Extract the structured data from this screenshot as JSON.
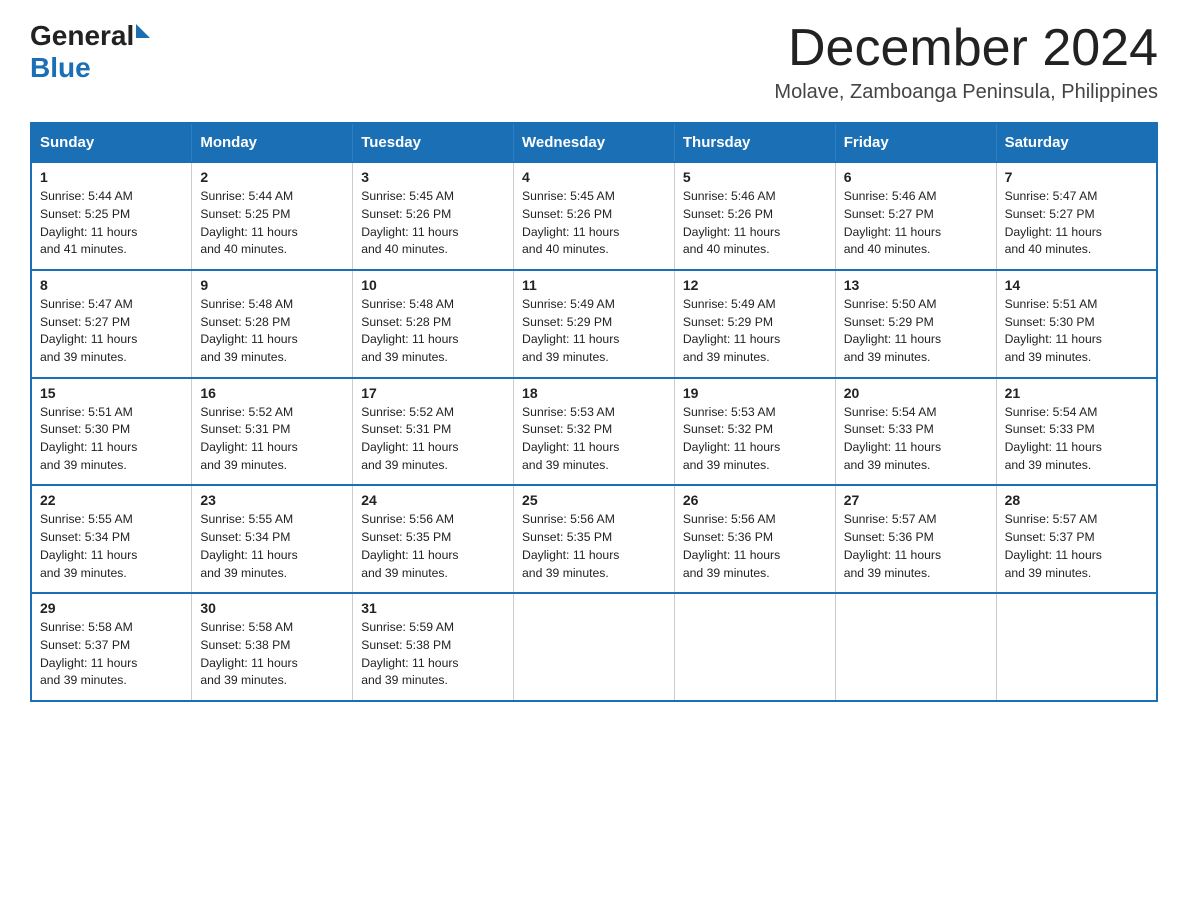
{
  "logo": {
    "general": "General",
    "blue": "Blue"
  },
  "title": "December 2024",
  "subtitle": "Molave, Zamboanga Peninsula, Philippines",
  "header_days": [
    "Sunday",
    "Monday",
    "Tuesday",
    "Wednesday",
    "Thursday",
    "Friday",
    "Saturday"
  ],
  "weeks": [
    [
      {
        "day": "1",
        "info": "Sunrise: 5:44 AM\nSunset: 5:25 PM\nDaylight: 11 hours\nand 41 minutes."
      },
      {
        "day": "2",
        "info": "Sunrise: 5:44 AM\nSunset: 5:25 PM\nDaylight: 11 hours\nand 40 minutes."
      },
      {
        "day": "3",
        "info": "Sunrise: 5:45 AM\nSunset: 5:26 PM\nDaylight: 11 hours\nand 40 minutes."
      },
      {
        "day": "4",
        "info": "Sunrise: 5:45 AM\nSunset: 5:26 PM\nDaylight: 11 hours\nand 40 minutes."
      },
      {
        "day": "5",
        "info": "Sunrise: 5:46 AM\nSunset: 5:26 PM\nDaylight: 11 hours\nand 40 minutes."
      },
      {
        "day": "6",
        "info": "Sunrise: 5:46 AM\nSunset: 5:27 PM\nDaylight: 11 hours\nand 40 minutes."
      },
      {
        "day": "7",
        "info": "Sunrise: 5:47 AM\nSunset: 5:27 PM\nDaylight: 11 hours\nand 40 minutes."
      }
    ],
    [
      {
        "day": "8",
        "info": "Sunrise: 5:47 AM\nSunset: 5:27 PM\nDaylight: 11 hours\nand 39 minutes."
      },
      {
        "day": "9",
        "info": "Sunrise: 5:48 AM\nSunset: 5:28 PM\nDaylight: 11 hours\nand 39 minutes."
      },
      {
        "day": "10",
        "info": "Sunrise: 5:48 AM\nSunset: 5:28 PM\nDaylight: 11 hours\nand 39 minutes."
      },
      {
        "day": "11",
        "info": "Sunrise: 5:49 AM\nSunset: 5:29 PM\nDaylight: 11 hours\nand 39 minutes."
      },
      {
        "day": "12",
        "info": "Sunrise: 5:49 AM\nSunset: 5:29 PM\nDaylight: 11 hours\nand 39 minutes."
      },
      {
        "day": "13",
        "info": "Sunrise: 5:50 AM\nSunset: 5:29 PM\nDaylight: 11 hours\nand 39 minutes."
      },
      {
        "day": "14",
        "info": "Sunrise: 5:51 AM\nSunset: 5:30 PM\nDaylight: 11 hours\nand 39 minutes."
      }
    ],
    [
      {
        "day": "15",
        "info": "Sunrise: 5:51 AM\nSunset: 5:30 PM\nDaylight: 11 hours\nand 39 minutes."
      },
      {
        "day": "16",
        "info": "Sunrise: 5:52 AM\nSunset: 5:31 PM\nDaylight: 11 hours\nand 39 minutes."
      },
      {
        "day": "17",
        "info": "Sunrise: 5:52 AM\nSunset: 5:31 PM\nDaylight: 11 hours\nand 39 minutes."
      },
      {
        "day": "18",
        "info": "Sunrise: 5:53 AM\nSunset: 5:32 PM\nDaylight: 11 hours\nand 39 minutes."
      },
      {
        "day": "19",
        "info": "Sunrise: 5:53 AM\nSunset: 5:32 PM\nDaylight: 11 hours\nand 39 minutes."
      },
      {
        "day": "20",
        "info": "Sunrise: 5:54 AM\nSunset: 5:33 PM\nDaylight: 11 hours\nand 39 minutes."
      },
      {
        "day": "21",
        "info": "Sunrise: 5:54 AM\nSunset: 5:33 PM\nDaylight: 11 hours\nand 39 minutes."
      }
    ],
    [
      {
        "day": "22",
        "info": "Sunrise: 5:55 AM\nSunset: 5:34 PM\nDaylight: 11 hours\nand 39 minutes."
      },
      {
        "day": "23",
        "info": "Sunrise: 5:55 AM\nSunset: 5:34 PM\nDaylight: 11 hours\nand 39 minutes."
      },
      {
        "day": "24",
        "info": "Sunrise: 5:56 AM\nSunset: 5:35 PM\nDaylight: 11 hours\nand 39 minutes."
      },
      {
        "day": "25",
        "info": "Sunrise: 5:56 AM\nSunset: 5:35 PM\nDaylight: 11 hours\nand 39 minutes."
      },
      {
        "day": "26",
        "info": "Sunrise: 5:56 AM\nSunset: 5:36 PM\nDaylight: 11 hours\nand 39 minutes."
      },
      {
        "day": "27",
        "info": "Sunrise: 5:57 AM\nSunset: 5:36 PM\nDaylight: 11 hours\nand 39 minutes."
      },
      {
        "day": "28",
        "info": "Sunrise: 5:57 AM\nSunset: 5:37 PM\nDaylight: 11 hours\nand 39 minutes."
      }
    ],
    [
      {
        "day": "29",
        "info": "Sunrise: 5:58 AM\nSunset: 5:37 PM\nDaylight: 11 hours\nand 39 minutes."
      },
      {
        "day": "30",
        "info": "Sunrise: 5:58 AM\nSunset: 5:38 PM\nDaylight: 11 hours\nand 39 minutes."
      },
      {
        "day": "31",
        "info": "Sunrise: 5:59 AM\nSunset: 5:38 PM\nDaylight: 11 hours\nand 39 minutes."
      },
      {
        "day": "",
        "info": ""
      },
      {
        "day": "",
        "info": ""
      },
      {
        "day": "",
        "info": ""
      },
      {
        "day": "",
        "info": ""
      }
    ]
  ]
}
